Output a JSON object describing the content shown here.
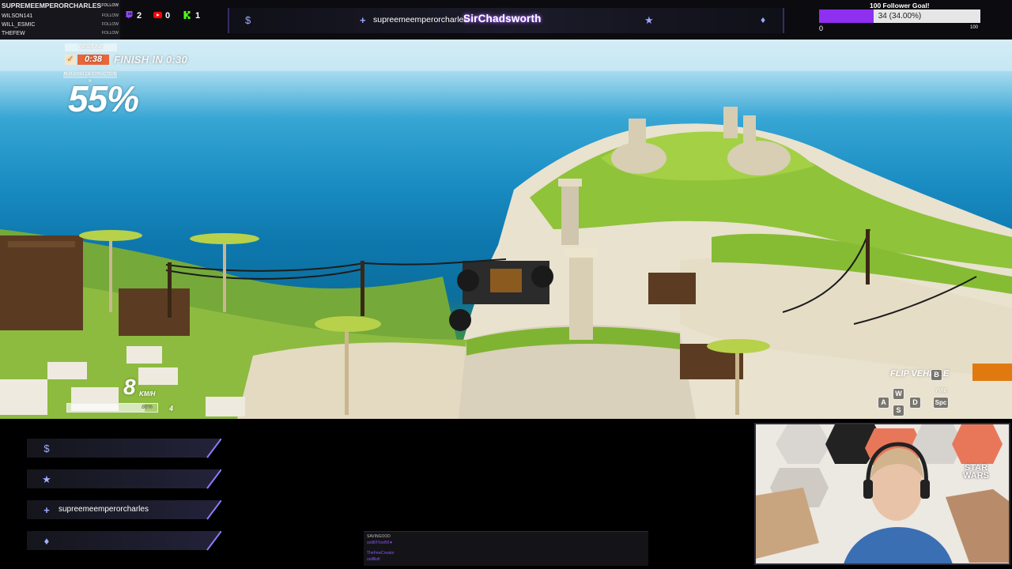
{
  "viewers": {
    "list": [
      "SUPREMEEMPERORCHARLES",
      "WILSON141",
      "WILL_ESMIC",
      "THEFEW"
    ],
    "follow_label": "FOLLOW"
  },
  "socials": {
    "twitch": {
      "count": "2",
      "color": "#9146ff",
      "icon": "twitch-icon"
    },
    "youtube": {
      "count": "0",
      "color": "#ff0000",
      "icon": "youtube-icon"
    },
    "kick": {
      "count": "1",
      "color": "#53fc18",
      "icon": "kick-icon"
    }
  },
  "event_bar": {
    "icons": [
      "dollar-icon",
      "follow-plus-icon",
      "star-icon",
      "diamond-icon"
    ],
    "follower_name": "supreemeemperorcharles",
    "headline": "SirChadsworth",
    "accent": "#9aa7ff"
  },
  "goal": {
    "title": "100 Follower Goal!",
    "progress_text": "34 (34.00%)",
    "progress": 0.34,
    "min": "0",
    "max": "100",
    "fill_color": "#8f2ff0"
  },
  "game_hud": {
    "deadline_label": "DEADLINE",
    "timer": "0:38",
    "finish_text": "FINISH IN 0:30",
    "destruction_label": "BUILDING DESTRUCTION %",
    "destruction_percent": "55%",
    "speed": "8",
    "speed_unit": "KM/H",
    "health_text": "86%",
    "health": 0.86,
    "gear": "4",
    "flip_label": "FLIP VEHICLE",
    "flip_key": "B",
    "keys": {
      "up": "W",
      "left": "A",
      "down": "S",
      "right": "D"
    },
    "fire_label": "FIRE",
    "fire_key": "Spc"
  },
  "event_list": [
    {
      "icon": "dollar-icon",
      "glyph": "$",
      "label": ""
    },
    {
      "icon": "star-icon",
      "glyph": "★",
      "label": ""
    },
    {
      "icon": "follow-plus-icon",
      "glyph": "+",
      "label": "supreemeemperorcharles"
    },
    {
      "icon": "diamond-icon",
      "glyph": "♦",
      "label": ""
    }
  ],
  "chat": {
    "lines": [
      "SAVINGOOD",
      "oolIlII!!!ool!Ill ♥",
      "TheFewCreator",
      "oolIlllolI"
    ]
  },
  "webcam": {
    "logo_line1": "STAR",
    "logo_line2": "WARS"
  }
}
